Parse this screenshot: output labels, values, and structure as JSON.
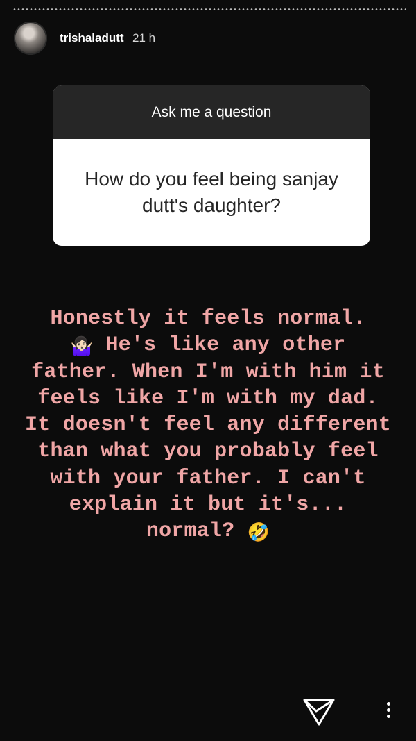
{
  "story": {
    "username": "trishaladutt",
    "time_ago": "21 h",
    "avatar_icon": "profile-photo"
  },
  "question_sticker": {
    "prompt": "Ask me a question",
    "question": "How do you feel being sanjay dutt's daughter?"
  },
  "answer": {
    "line1": "Honestly it feels normal.",
    "emoji1": "🤷🏻‍♀️",
    "line2": " He's like any other father. When I'm with him it feels like I'm with my dad. It doesn't feel any different than what you probably feel with your father. I can't explain it but it's... normal?",
    "emoji2": "🤣",
    "text_color": "#f0a6a6"
  },
  "icons": {
    "send": "send-icon",
    "more": "more-options-icon"
  }
}
